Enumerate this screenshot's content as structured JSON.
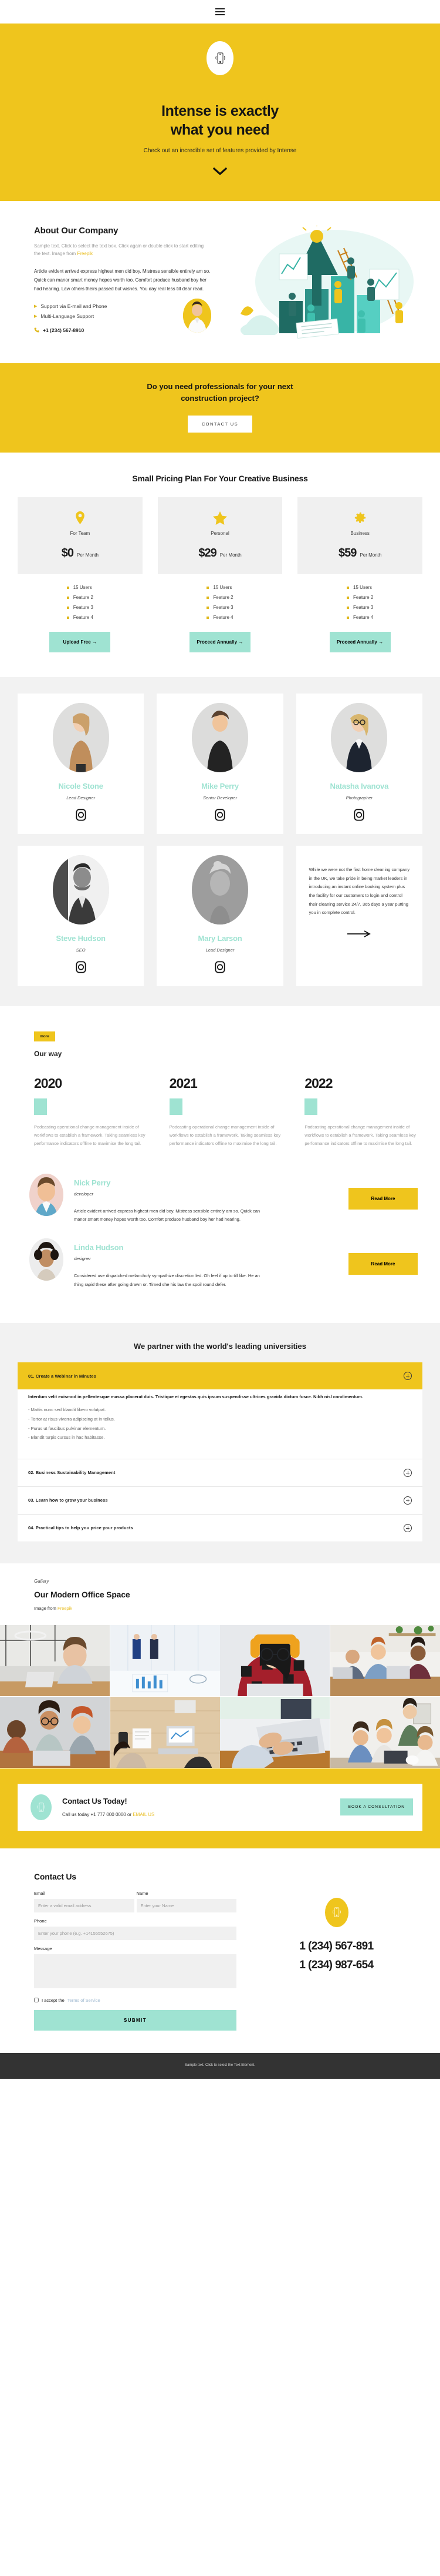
{
  "brand": {
    "yellow": "#efc51d",
    "mint": "#9fe3d2",
    "dark": "#333333"
  },
  "topbar": {
    "menu_icon": "hamburger-icon"
  },
  "hero": {
    "icon": "mobile-phone-icon",
    "title_line1": "Intense is exactly",
    "title_line2": "what you need",
    "subtitle": "Check out an incredible set of features provided by Intense",
    "scroll_icon": "chevron-down-icon"
  },
  "about": {
    "heading": "About Our Company",
    "sample_text": "Sample text. Click to select the text box. Click again or double click to start editing the text. Image from ",
    "sample_link": "Freepik",
    "body": "Article evident arrived express highest men did boy. Mistress sensible entirely am so. Quick can manor smart money hopes worth too. Comfort produce husband boy her had hearing. Law others theirs passed but wishes. You day real less till dear read.",
    "features": [
      "Support via E-mail and Phone",
      "Multi-Language Support"
    ],
    "phone": "+1 (234) 567-8910",
    "phone_icon": "phone-icon",
    "illustration": "business-growth-illustration",
    "avatar": "man-avatar"
  },
  "cta_band": {
    "title_line1": "Do you need professionals for your next",
    "title_line2": "construction project?",
    "button": "CONTACT US"
  },
  "pricing": {
    "heading": "Small Pricing Plan For Your Creative Business",
    "plans": [
      {
        "icon": "map-pin-icon",
        "name": "For Team",
        "amount": "$0",
        "per": "Per Month",
        "features": [
          "15 Users",
          "Feature 2",
          "Feature 3",
          "Feature 4"
        ],
        "button": "Upload Free →"
      },
      {
        "icon": "star-icon",
        "name": "Personal",
        "amount": "$29",
        "per": "Per Month",
        "features": [
          "15 Users",
          "Feature 2",
          "Feature 3",
          "Feature 4"
        ],
        "button": "Proceed Annually →"
      },
      {
        "icon": "gear-icon",
        "name": "Business",
        "amount": "$59",
        "per": "Per Month",
        "features": [
          "15 Users",
          "Feature 2",
          "Feature 3",
          "Feature 4"
        ],
        "button": "Proceed Annually →"
      }
    ]
  },
  "team": {
    "members": [
      {
        "name": "Nicole Stone",
        "role": "Lead Designer",
        "social_icon": "instagram-icon",
        "photo": "woman-in-tan-sweater"
      },
      {
        "name": "Mike Perry",
        "role": "Senior Developer",
        "social_icon": "instagram-icon",
        "photo": "man-in-black-tshirt"
      },
      {
        "name": "Natasha Ivanova",
        "role": "Photographer",
        "social_icon": "instagram-icon",
        "photo": "woman-with-glasses-blazer"
      },
      {
        "name": "Steve Hudson",
        "role": "SEO",
        "social_icon": "instagram-icon",
        "photo": "bearded-man-bw"
      },
      {
        "name": "Mary Larson",
        "role": "Lead Designer",
        "social_icon": "instagram-icon",
        "photo": "blonde-woman-bw"
      }
    ],
    "quote": "While we were not the first home cleaning company in the UK, we take pride in being market leaders in introducing an instant online booking system plus the facility for our customers to login and control their cleaning service 24/7, 365 days a year putting you in complete control.",
    "quote_arrow_icon": "arrow-right-icon"
  },
  "ourway": {
    "pill": "more",
    "heading": "Our way",
    "items": [
      {
        "year": "2020",
        "text": "Podcasting operational change management inside of workflows to establish a framework. Taking seamless key performance indicators offline to maximise the long tail."
      },
      {
        "year": "2021",
        "text": "Podcasting operational change management inside of workflows to establish a framework. Taking seamless key performance indicators offline to maximise the long tail."
      },
      {
        "year": "2022",
        "text": "Podcasting operational change management inside of workflows to establish a framework. Taking seamless key performance indicators offline to maximise the long tail."
      }
    ]
  },
  "authors": [
    {
      "name": "Nick Perry",
      "role": "developer",
      "text": "Article evident arrived express highest men did boy. Mistress sensible entirely am so. Quick can manor smart money hopes worth too. Comfort produce husband boy her had hearing.",
      "button": "Read More",
      "photo": "young-man-portrait"
    },
    {
      "name": "Linda Hudson",
      "role": "designer",
      "text": "Considered use dispatched melancholy sympathize discretion led. Oh feel if up to till like. He an thing rapid these after going drawn or. Timed she his law the spoil round defer.",
      "button": "Read More",
      "photo": "curly-hair-woman-portrait"
    }
  ],
  "accordion": {
    "heading": "We partner with the world's leading universities",
    "items": [
      {
        "title": "01. Create a Webinar in Minutes",
        "open": true,
        "lead": "Interdum velit euismod in pellentesque massa placerat duis. Tristique et egestas quis ipsum suspendisse ultrices gravida dictum fusce. Nibh nisl condimentum.",
        "bullets": [
          "-  Mattis nunc sed blandit libero volutpat.",
          "-  Tortor at risus viverra adipiscing at in tellus.",
          "-  Purus ut faucibus pulvinar elementum.",
          "-  Blandit turpis cursus in hac habitasse."
        ]
      },
      {
        "title": "02. Business Sustainability Management",
        "open": false,
        "lead": "",
        "bullets": []
      },
      {
        "title": "03. Learn how to grow your business",
        "open": false,
        "lead": "",
        "bullets": []
      },
      {
        "title": "04. Practical tips to help you price your products",
        "open": false,
        "lead": "",
        "bullets": []
      }
    ],
    "toggle_icon": "plus-icon"
  },
  "gallery": {
    "kicker": "Gallery",
    "heading": "Our Modern Office Space",
    "credit_prefix": "Image from ",
    "credit_link": "Freepik",
    "images": [
      "bearded-man-at-laptop-office",
      "two-businessmen-with-charts",
      "woman-with-orange-headphones",
      "team-at-table-with-laptops",
      "three-colleagues-collaborating",
      "overhead-desk-with-tablet",
      "hands-typing-on-laptop",
      "group-meeting-smiling"
    ]
  },
  "today": {
    "icon": "mobile-phone-icon",
    "title": "Contact Us Today!",
    "line_prefix": "Call us today +1 777 000 0000 or ",
    "line_link": "EMAIL US",
    "button": "BOOK A CONSULTATION"
  },
  "contact": {
    "heading": "Contact Us",
    "email_label": "Email",
    "email_placeholder": "Enter a valid email address",
    "name_label": "Name",
    "name_placeholder": "Enter your Name",
    "phone_label": "Phone",
    "phone_placeholder": "Enter your phone (e.g. +14155552675)",
    "message_label": "Message",
    "message_placeholder": "",
    "terms_prefix": "I accept the ",
    "terms_link": "Terms of Service",
    "submit": "SUBMIT",
    "badge_icon": "mobile-phone-icon",
    "phone_1": "1 (234) 567-891",
    "phone_2": "1 (234) 987-654"
  },
  "footer": {
    "text": "Sample text. Click to select the Text Element."
  }
}
